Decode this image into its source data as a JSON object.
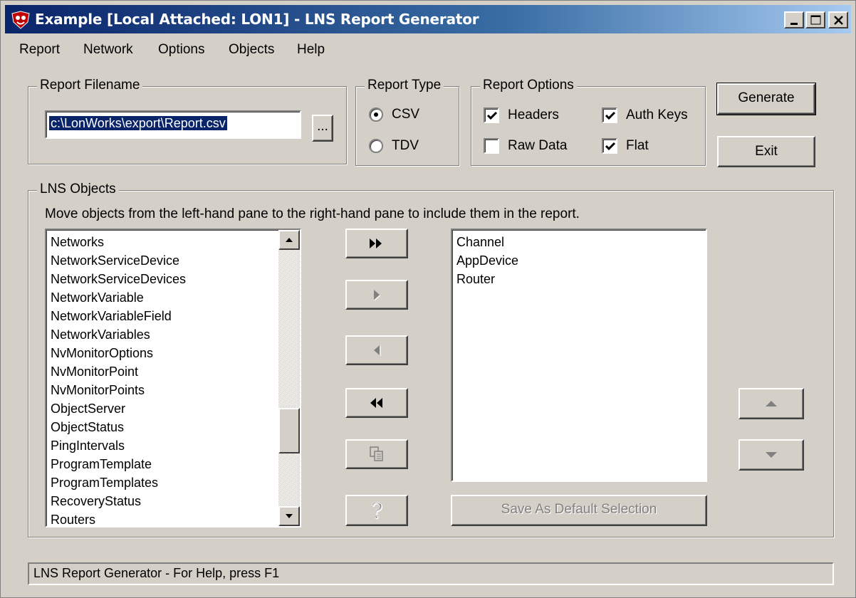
{
  "window": {
    "title": "Example [Local Attached: LON1] - LNS Report Generator",
    "title_gradient_start": "#0a246a",
    "title_gradient_end": "#a6caf0"
  },
  "menu": [
    "Report",
    "Network",
    "Options",
    "Objects",
    "Help"
  ],
  "report_filename": {
    "legend": "Report Filename",
    "value": "c:\\LonWorks\\export\\Report.csv",
    "browse_label": "..."
  },
  "report_type": {
    "legend": "Report Type",
    "options": [
      {
        "label": "CSV",
        "selected": true
      },
      {
        "label": "TDV",
        "selected": false
      }
    ]
  },
  "report_options": {
    "legend": "Report Options",
    "items": [
      {
        "label": "Headers",
        "checked": true
      },
      {
        "label": "Auth Keys",
        "checked": true
      },
      {
        "label": "Raw Data",
        "checked": false
      },
      {
        "label": "Flat",
        "checked": true
      }
    ]
  },
  "buttons": {
    "generate": "Generate",
    "exit": "Exit",
    "save_default": "Save As Default Selection"
  },
  "lns_objects": {
    "legend": "LNS Objects",
    "instructions": "Move objects from the left-hand pane to the right-hand pane to include them in the report.",
    "available": [
      "Networks",
      "NetworkServiceDevice",
      "NetworkServiceDevices",
      "NetworkVariable",
      "NetworkVariableField",
      "NetworkVariables",
      "NvMonitorOptions",
      "NvMonitorPoint",
      "NvMonitorPoints",
      "ObjectServer",
      "ObjectStatus",
      "PingIntervals",
      "ProgramTemplate",
      "ProgramTemplates",
      "RecoveryStatus",
      "Routers"
    ],
    "selected": [
      "Channel",
      "AppDevice",
      "Router"
    ],
    "transfer_buttons": [
      {
        "icon": "double-right-icon",
        "enabled": true
      },
      {
        "icon": "right-icon",
        "enabled": false
      },
      {
        "icon": "left-icon",
        "enabled": false
      },
      {
        "icon": "double-left-icon",
        "enabled": true
      },
      {
        "icon": "copy-icon",
        "enabled": false
      },
      {
        "icon": "help-icon",
        "enabled": false
      }
    ]
  },
  "status_bar": "LNS Report Generator - For Help, press F1"
}
